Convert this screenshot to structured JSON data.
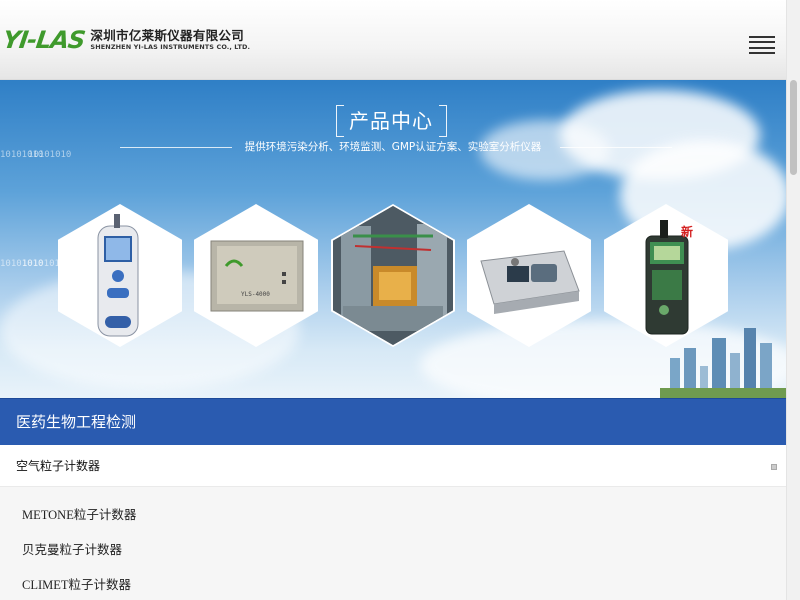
{
  "header": {
    "logo_mark": "YI-LAS",
    "company_cn": "深圳市亿莱斯仪器有限公司",
    "company_en": "SHENZHEN YI-LAS INSTRUMENTS CO., LTD."
  },
  "banner": {
    "title": "产品中心",
    "subtitle": "提供环境污染分析、环境监测、GMP认证方案、实验室分析仪器",
    "badge": "新",
    "binary_text": "10101010",
    "products": [
      "handheld-particle-counter-image",
      "yls-4000-analyzer-image",
      "circuit-board-image",
      "portable-particle-counter-image",
      "green-monitor-image"
    ],
    "device_label": "YLS-4000"
  },
  "category": {
    "title": "医药生物工程检测",
    "subcategory": "空气粒子计数器",
    "items": [
      "METONE粒子计数器",
      "贝克曼粒子计数器",
      "CLIMET粒子计数器"
    ]
  }
}
